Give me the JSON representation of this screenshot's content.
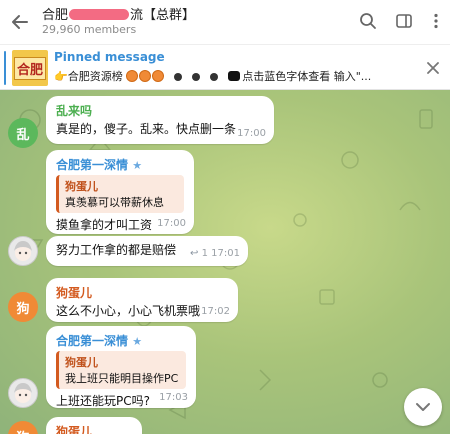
{
  "header": {
    "title_start": "合肥",
    "title_end": "流【总群】",
    "members": "29,960 members"
  },
  "pinned": {
    "label": "Pinned message",
    "thumb_text": "合肥",
    "text_a": "👉合肥资源榜",
    "text_b": "点击蓝色字体查看  输入\"..."
  },
  "messages": [
    {
      "sender": "乱来吗",
      "sender_color": "#4caf50",
      "avatar_letter": "乱",
      "avatar_color": "#5cb85c",
      "text": "真是的，傻子。乱来。快点删一条",
      "time": "17:00"
    },
    {
      "sender": "合肥第一深情",
      "sender_color": "#3a8fd6",
      "quote_name": "狗蛋儿",
      "quote_text": "真羡慕可以带薪休息",
      "text": "摸鱼拿的才叫工资",
      "time": "17:00"
    },
    {
      "text": "努力工作拿的都是赔偿",
      "reply_count": "1",
      "time": "17:01"
    },
    {
      "sender": "狗蛋儿",
      "sender_color": "#d35a1f",
      "avatar_letter": "狗",
      "avatar_color": "#f08a36",
      "text": "这么不小心，小心飞机票哦",
      "time": "17:02"
    },
    {
      "sender": "合肥第一深情",
      "sender_color": "#3a8fd6",
      "quote_name": "狗蛋儿",
      "quote_text": "我上班只能明目操作PC",
      "text": "上班还能玩PC吗?",
      "time": "17:03"
    },
    {
      "sender": "狗蛋儿",
      "sender_color": "#d35a1f",
      "avatar_letter": "狗",
      "avatar_color": "#f08a36"
    }
  ]
}
